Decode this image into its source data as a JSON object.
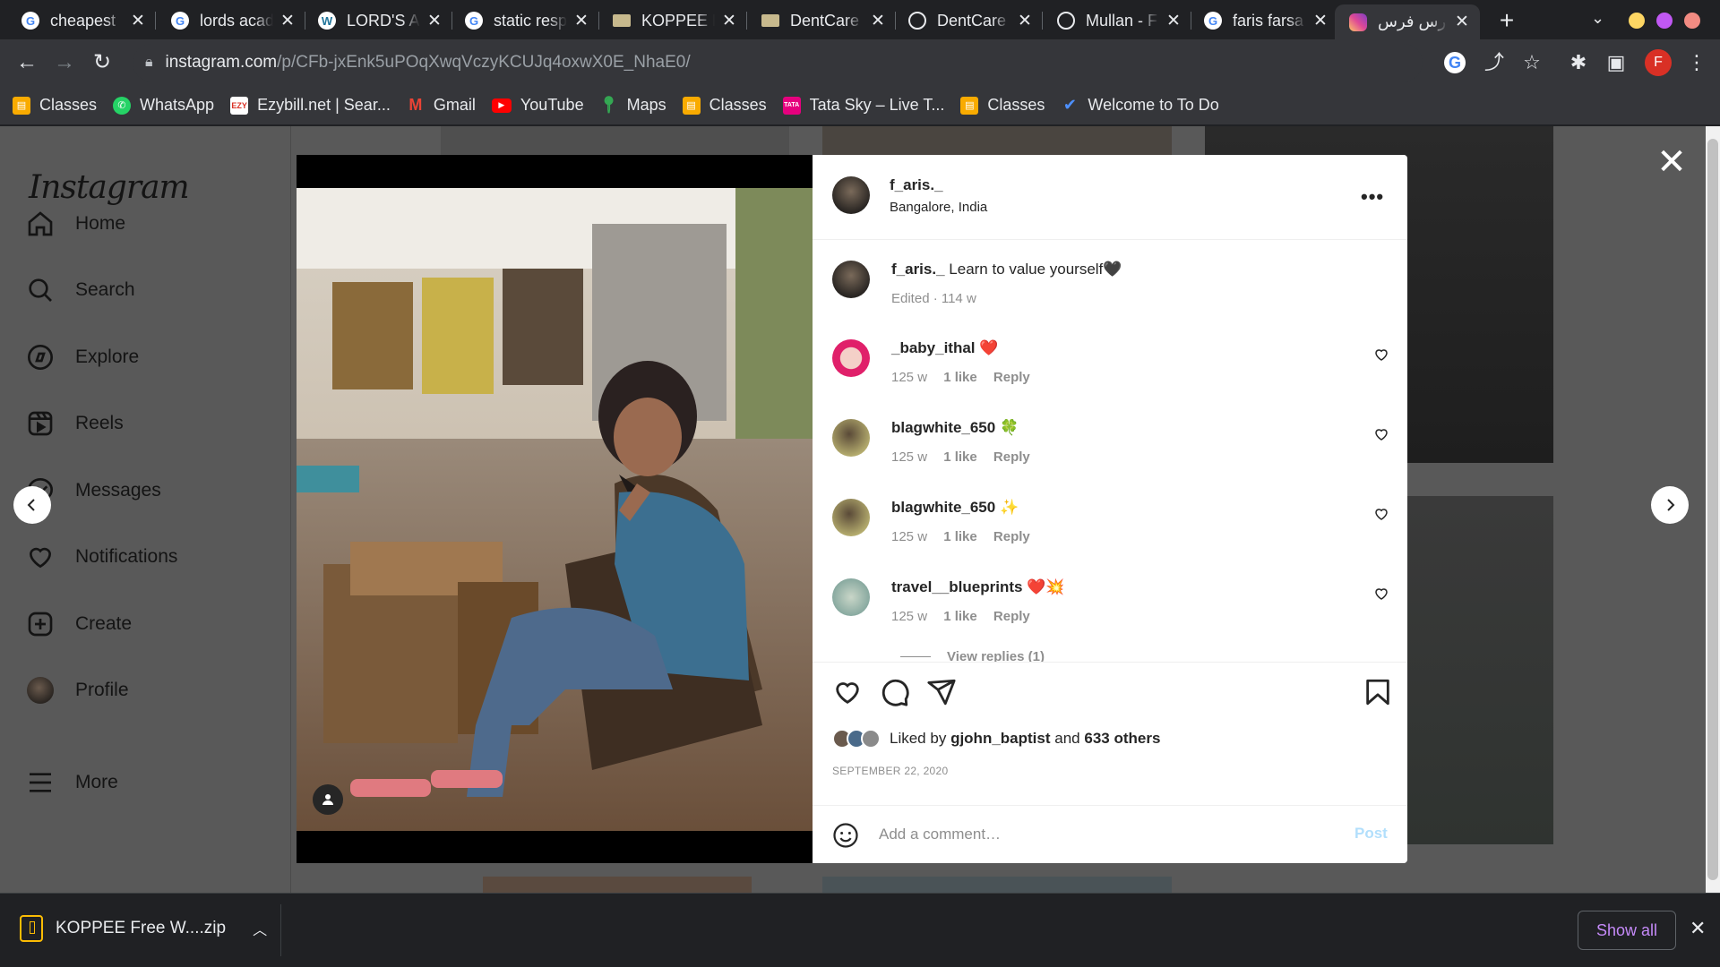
{
  "browser": {
    "tabs": [
      {
        "title": "cheapest",
        "favicon": "google-icon"
      },
      {
        "title": "lords acad",
        "favicon": "google-icon"
      },
      {
        "title": "LORD'S AC",
        "favicon": "wordpress-icon"
      },
      {
        "title": "static resp",
        "favicon": "google-icon"
      },
      {
        "title": "KOPPEE F",
        "favicon": "site-icon"
      },
      {
        "title": "DentCare",
        "favicon": "site-icon"
      },
      {
        "title": "DentCare",
        "favicon": "globe-icon"
      },
      {
        "title": "Mullan - F",
        "favicon": "globe-icon"
      },
      {
        "title": "faris farsa",
        "favicon": "google-icon"
      },
      {
        "title": "فارس فرس",
        "favicon": "instagram-icon",
        "active": true
      }
    ],
    "url_host": "instagram.com",
    "url_path": "/p/CFb-jxEnk5uPOqXwqVczyKCUJq4oxwX0E_NhaE0/",
    "profile_initial": "F",
    "bookmarks": [
      "Classes",
      "WhatsApp",
      "Ezybill.net | Sear...",
      "Gmail",
      "YouTube",
      "Maps",
      "Classes",
      "Tata Sky – Live T...",
      "Classes",
      "Welcome to To Do"
    ],
    "accent_colors": {
      "min": "#fdd663",
      "max": "#c058f3",
      "close": "#f28b82"
    }
  },
  "sidebar": {
    "logo": "Instagram",
    "items": [
      {
        "label": "Home",
        "icon": "home-icon"
      },
      {
        "label": "Search",
        "icon": "search-icon"
      },
      {
        "label": "Explore",
        "icon": "compass-icon"
      },
      {
        "label": "Reels",
        "icon": "reels-icon"
      },
      {
        "label": "Messages",
        "icon": "messenger-icon"
      },
      {
        "label": "Notifications",
        "icon": "heart-icon"
      },
      {
        "label": "Create",
        "icon": "plus-square-icon"
      },
      {
        "label": "Profile",
        "icon": "avatar"
      },
      {
        "label": "More",
        "icon": "hamburger-icon"
      }
    ]
  },
  "post": {
    "username": "f_aris._",
    "location": "Bangalore, India",
    "caption": {
      "user": "f_aris._",
      "text": "Learn to value yourself🖤",
      "meta": "Edited · 114 w"
    },
    "comments": [
      {
        "user": "_baby_ithal",
        "text": "❤️",
        "age": "125 w",
        "likes": "1 like",
        "reply": "Reply"
      },
      {
        "user": "blagwhite_650",
        "text": "🍀",
        "age": "125 w",
        "likes": "1 like",
        "reply": "Reply"
      },
      {
        "user": "blagwhite_650",
        "text": "✨",
        "age": "125 w",
        "likes": "1 like",
        "reply": "Reply"
      },
      {
        "user": "travel__blueprints",
        "text": "❤️💥",
        "age": "125 w",
        "likes": "1 like",
        "reply": "Reply"
      }
    ],
    "view_replies": "View replies (1)",
    "liked_by_prefix": "Liked by",
    "liked_by_user": "gjohn_baptist",
    "liked_by_and": "and",
    "liked_by_others": "633 others",
    "date": "SEPTEMBER 22, 2020",
    "comment_placeholder": "Add a comment…",
    "post_label": "Post"
  },
  "downloads": {
    "file": "KOPPEE Free W....zip",
    "show_all": "Show all"
  }
}
